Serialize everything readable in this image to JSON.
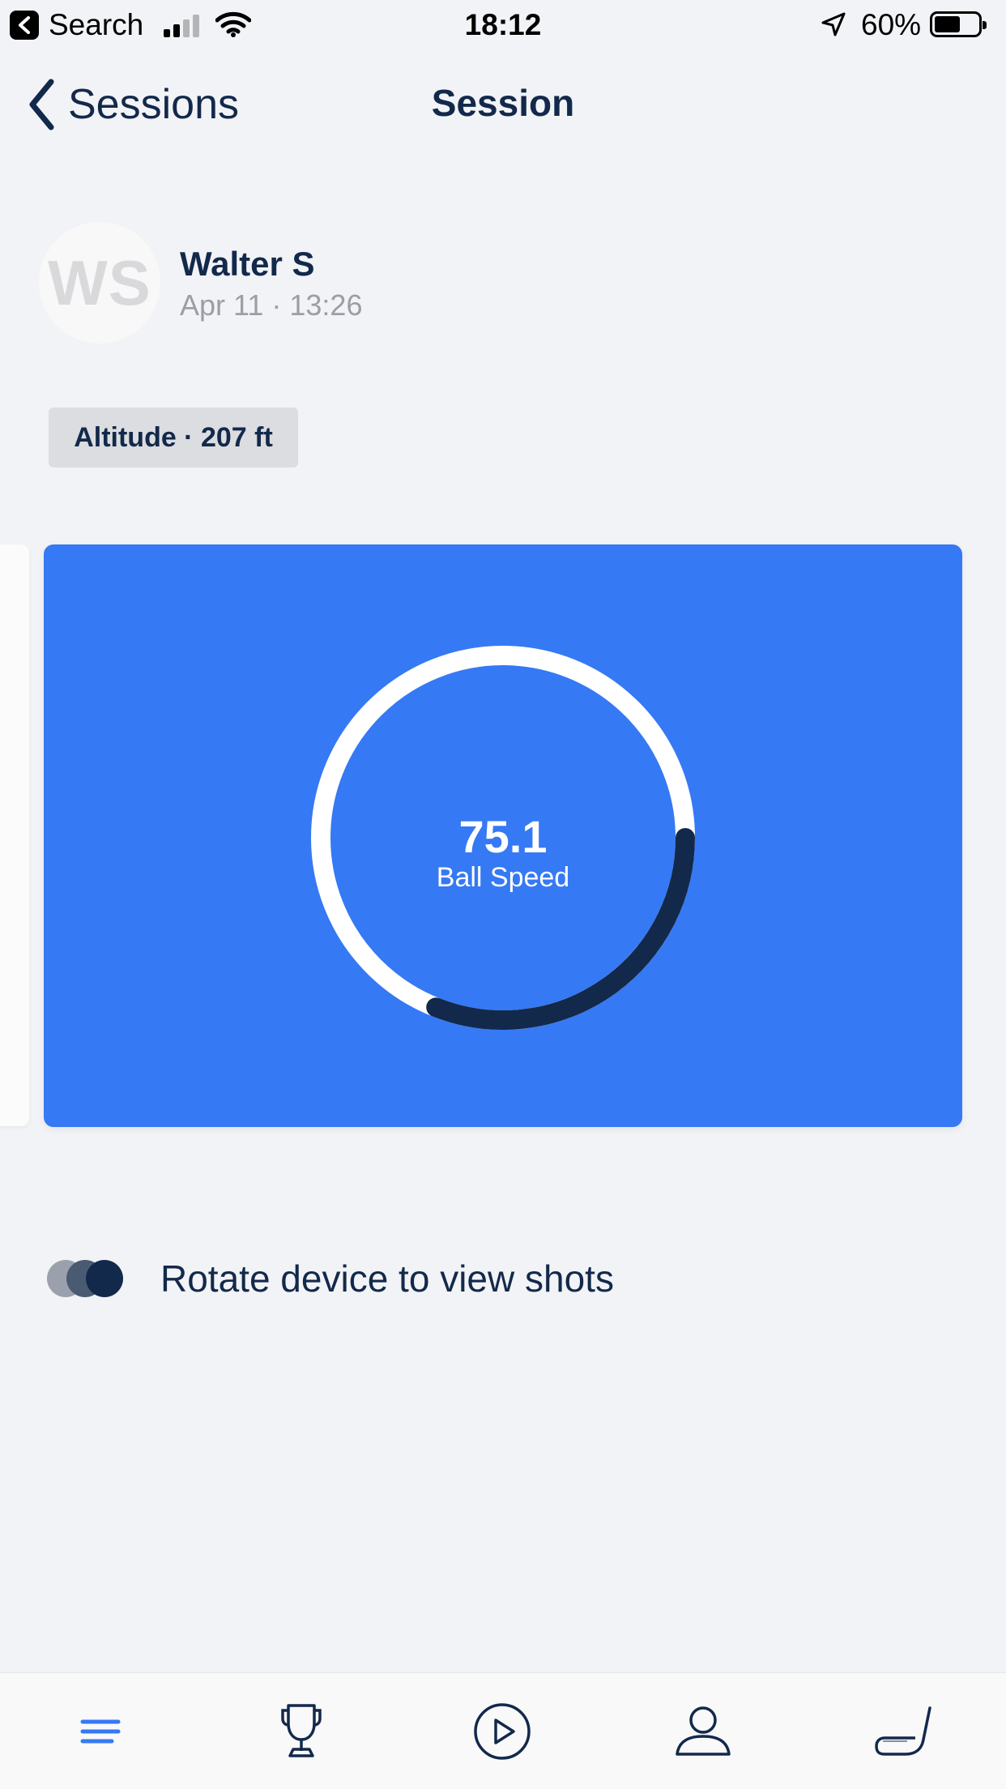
{
  "status_bar": {
    "back_app": "Search",
    "time": "18:12",
    "battery_percent": "60%",
    "battery_level": 0.6
  },
  "nav": {
    "back_label": "Sessions",
    "title": "Session"
  },
  "profile": {
    "initials": "WS",
    "name": "Walter S",
    "date": "Apr 11 · 13:26"
  },
  "badge": {
    "label": "Altitude · 207 ft"
  },
  "metric_card": {
    "value": "75.1",
    "label": "Ball Speed",
    "background": "#3579f4",
    "progress_fraction": 0.2
  },
  "rotate_hint": {
    "text": "Rotate device to view shots"
  },
  "tab_bar": {
    "tabs": [
      {
        "icon": "menu-icon",
        "active": true
      },
      {
        "icon": "trophy-icon",
        "active": false
      },
      {
        "icon": "play-icon",
        "active": false
      },
      {
        "icon": "profile-icon",
        "active": false
      },
      {
        "icon": "golf-club-icon",
        "active": false
      }
    ],
    "active_color": "#3579f4",
    "inactive_color": "#13294b"
  },
  "colors": {
    "navy": "#13294b",
    "accent": "#3579f4",
    "background": "#f2f3f6"
  }
}
